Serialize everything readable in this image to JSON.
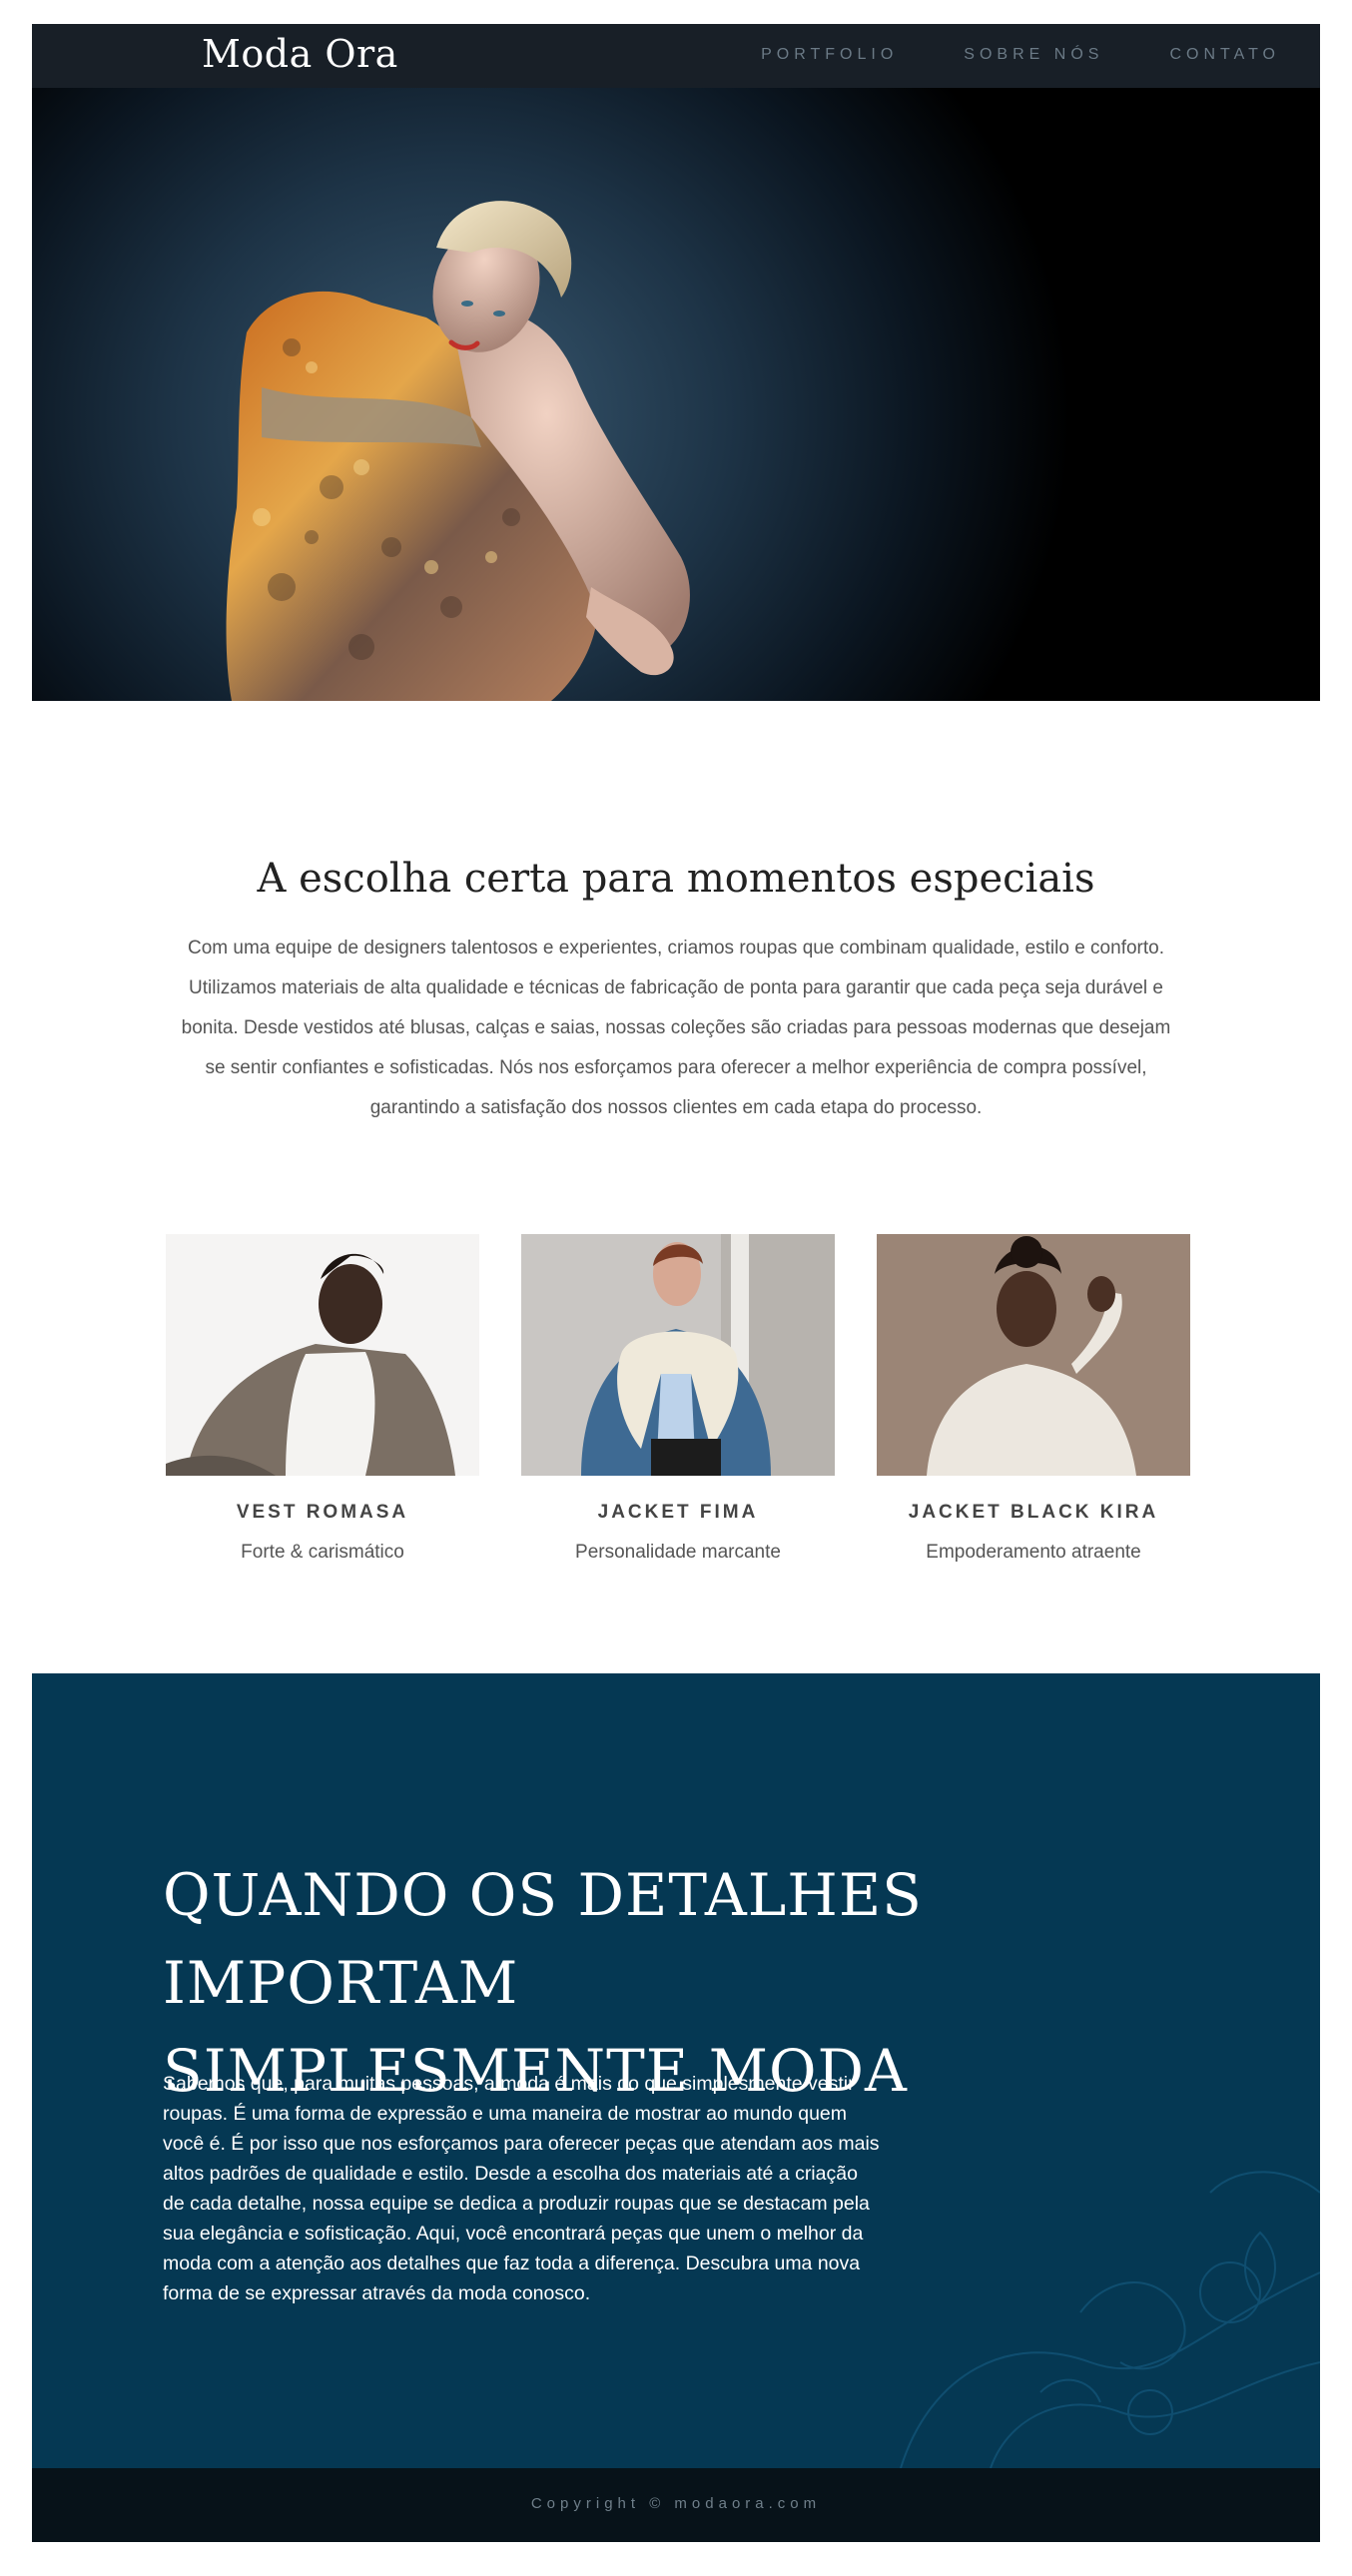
{
  "header": {
    "logo": "Moda Ora",
    "nav": [
      "PORTFOLIO",
      "SOBRE NÓS",
      "CONTATO"
    ]
  },
  "hero": {
    "image_description_icon": "fashion-model-photo"
  },
  "intro": {
    "title": "A escolha certa para momentos especiais",
    "text": "Com uma equipe de designers talentosos e experientes, criamos roupas que combinam qualidade, estilo e conforto. Utilizamos materiais de alta qualidade e técnicas de fabricação de ponta para garantir que cada peça seja durável e bonita. Desde vestidos até blusas, calças e saias, nossas coleções são criadas para pessoas modernas que desejam se sentir confiantes e sofisticadas. Nós nos esforçamos para oferecer a melhor experiência de compra possível, garantindo a satisfação dos nossos clientes em cada etapa do processo."
  },
  "products": [
    {
      "name": "VEST ROMASA",
      "tagline": "Forte & carismático"
    },
    {
      "name": "JACKET FIMA",
      "tagline": "Personalidade marcante"
    },
    {
      "name": "JACKET BLACK KIRA",
      "tagline": "Empoderamento atraente"
    }
  ],
  "details": {
    "heading_line1": "QUANDO OS DETALHES IMPORTAM",
    "heading_line2": "SIMPLESMENTE MODA",
    "text": "Sabemos que, para muitas pessoas, a moda é mais do que simplesmente vestir roupas. É uma forma de expressão e uma maneira de mostrar ao mundo quem você é. É por isso que nos esforçamos para oferecer peças que atendam aos mais altos padrões de qualidade e estilo. Desde a escolha dos materiais até a criação de cada detalhe, nossa equipe se dedica a produzir roupas que se destacam pela sua elegância e sofisticação. Aqui, você encontrará peças que unem o melhor da moda com a atenção aos detalhes que faz toda a diferença. Descubra uma nova forma de se expressar através da moda conosco."
  },
  "footer": {
    "copyright": "Copyright © modaora.com"
  },
  "colors": {
    "header_bg": "#181f27",
    "section_bg": "#053853",
    "footer_bg": "#071219"
  }
}
